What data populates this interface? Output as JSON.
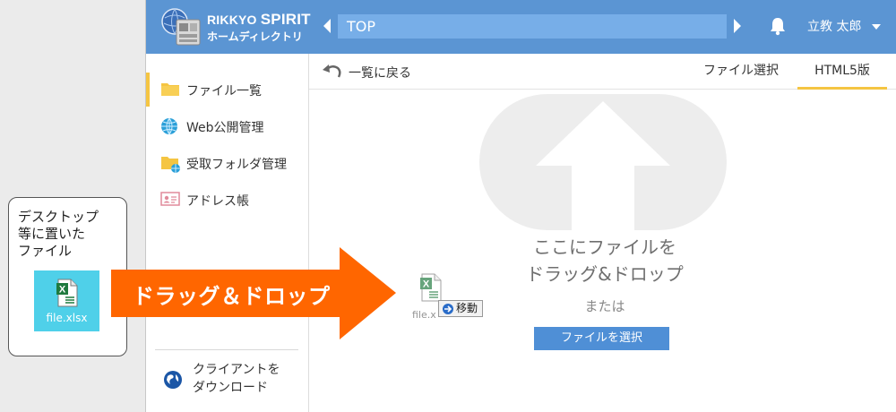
{
  "annotation": {
    "callout_text": "デスクトップ\n等に置いた\nファイル",
    "desktop_file_name": "file.xlsx",
    "arrow_label": "ドラッグ＆ドロップ",
    "arrow_color": "#ff6600"
  },
  "header": {
    "brand_line1_prefix": "RIKKYO ",
    "brand_line1_emph": "SPIRIT",
    "brand_line2": "ホームディレクトリ",
    "breadcrumb": "TOP",
    "user_name": "立教 太郎",
    "bg_color": "#5b95d3"
  },
  "sidebar": {
    "items": [
      {
        "label": "ファイル一覧",
        "icon": "folder-icon"
      },
      {
        "label": "Web公開管理",
        "icon": "globe-icon"
      },
      {
        "label": "受取フォルダ管理",
        "icon": "shared-folder-icon"
      },
      {
        "label": "アドレス帳",
        "icon": "address-card-icon"
      }
    ],
    "client_download": "クライアントを\nダウンロード"
  },
  "toolbar": {
    "back_label": "一覧に戻る",
    "tabs": [
      {
        "label": "ファイル選択"
      },
      {
        "label": "HTML5版"
      }
    ]
  },
  "dropzone": {
    "drop_text": "ここにファイルを\nドラッグ&ドロップ",
    "or_text": "または",
    "select_button": "ファイルを選択",
    "ghost_file_name": "file.x",
    "move_label": "移動"
  }
}
